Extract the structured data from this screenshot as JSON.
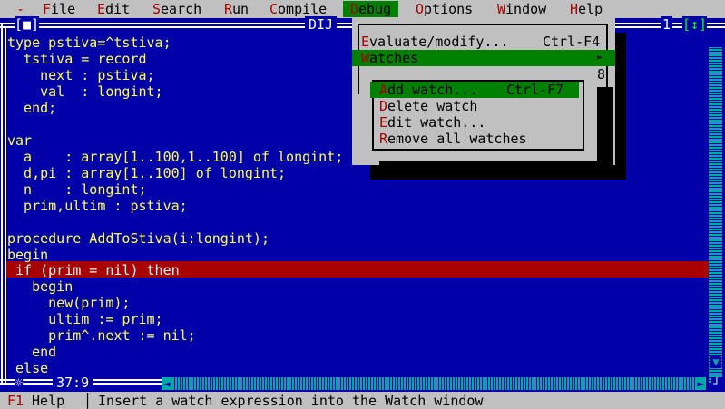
{
  "menubar": {
    "system": "-",
    "items": [
      {
        "label": "File",
        "hot": "F",
        "rest": "ile"
      },
      {
        "label": "Edit",
        "hot": "E",
        "rest": "dit"
      },
      {
        "label": "Search",
        "hot": "S",
        "rest": "earch"
      },
      {
        "label": "Run",
        "hot": "R",
        "rest": "un"
      },
      {
        "label": "Compile",
        "hot": "C",
        "rest": "ompile"
      },
      {
        "label": "Debug",
        "hot": "D",
        "rest": "ebug"
      },
      {
        "label": "Options",
        "hot": "O",
        "rest": "ptions"
      },
      {
        "label": "Window",
        "hot": "W",
        "rest": "indow"
      },
      {
        "label": "Help",
        "hot": "H",
        "rest": "elp"
      }
    ]
  },
  "editor": {
    "close_box": "[■]",
    "title": "DIJ",
    "window_number": "1",
    "zoom_box": "[↕]",
    "cursor_pos": "37:9",
    "modified_marker": "☼",
    "code_lines": [
      "type pstiva=^tstiva;",
      "  tstiva = record",
      "    next : pstiva;",
      "    val  : longint;",
      "  end;",
      "",
      "var",
      "  a    : array[1..100,1..100] of longint;",
      "  d,pi : array[1..100] of longint;",
      "  n    : longint;",
      "  prim,ultim : pstiva;",
      "",
      "procedure AddToStiva(i:longint);",
      "begin",
      " if (prim = nil) then",
      "   begin",
      "     new(prim);",
      "     ultim := prim;",
      "     prim^.next := nil;",
      "   end",
      " else"
    ]
  },
  "debug_menu": {
    "items": [
      {
        "hot": "E",
        "rest": "valuate/modify...",
        "shortcut": "Ctrl-F4"
      },
      {
        "hot": "W",
        "rest": "atches",
        "shortcut": "►"
      }
    ],
    "extra": "8"
  },
  "watches_menu": {
    "items": [
      {
        "hot": "A",
        "rest": "dd watch...",
        "shortcut": "Ctrl-F7"
      },
      {
        "hot": "D",
        "rest": "elete watch",
        "shortcut": ""
      },
      {
        "hot": "E",
        "rest": "dit watch...",
        "shortcut": ""
      },
      {
        "hot": "R",
        "rest": "emove all watches",
        "shortcut": ""
      }
    ]
  },
  "status": {
    "key": "F1",
    "key_label": " Help",
    "separator": "│",
    "message": "Insert a watch expression into the Watch window"
  },
  "colors": {
    "background": "#0000a8",
    "code_text": "#ffff54",
    "menu_bg": "#c0c0c0",
    "highlight": "#008000",
    "hotkey": "#a80000",
    "exec_line": "#a80000"
  }
}
